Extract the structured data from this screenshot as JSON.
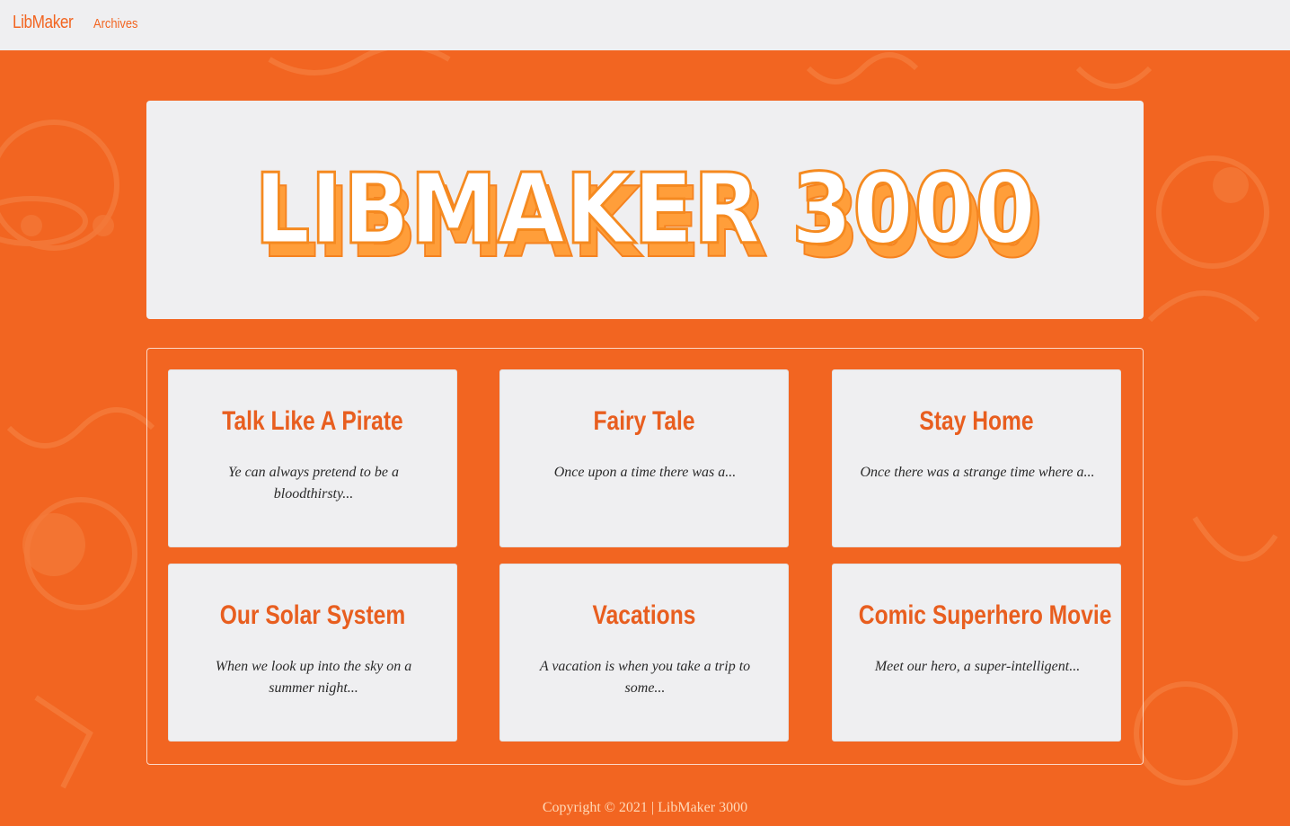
{
  "colors": {
    "accent": "#f26521",
    "panel": "#efeff1",
    "logo_fill": "#ffa23a"
  },
  "navbar": {
    "brand": "LibMaker",
    "links": [
      {
        "label": "Archives"
      }
    ]
  },
  "hero": {
    "logo_text": "LIBMAKER 3000"
  },
  "stories": [
    {
      "title": "Talk Like A Pirate",
      "excerpt": "Ye can always pretend to be a bloodthirsty..."
    },
    {
      "title": "Fairy Tale",
      "excerpt": "Once upon a time there was a..."
    },
    {
      "title": "Stay Home",
      "excerpt": "Once there was a strange time where a..."
    },
    {
      "title": "Our Solar System",
      "excerpt": "When we look up into the sky on a summer night..."
    },
    {
      "title": "Vacations",
      "excerpt": "A vacation is when you take a trip to some..."
    },
    {
      "title": "Comic Superhero Movie",
      "excerpt": "Meet our hero, a super-intelligent..."
    }
  ],
  "footer": {
    "text": "Copyright © 2021 | LibMaker 3000"
  }
}
